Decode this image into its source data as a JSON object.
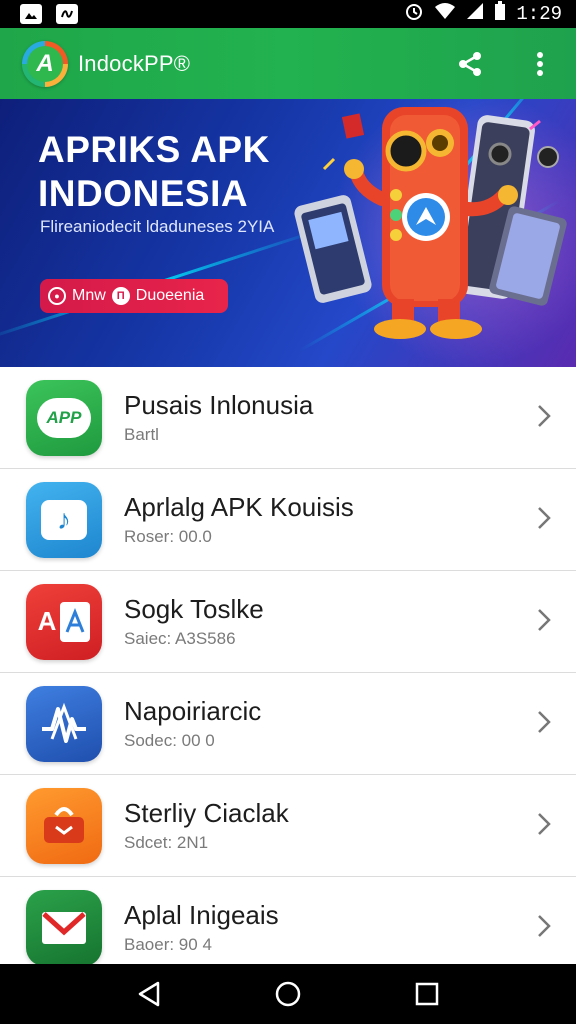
{
  "status_bar": {
    "time": "1:29",
    "icons": [
      "image-icon",
      "notification-icon",
      "alarm-icon",
      "wifi-icon",
      "signal-icon",
      "battery-icon"
    ]
  },
  "app_bar": {
    "logo_letter": "A",
    "title": "IndockPP®",
    "actions": [
      "share-icon",
      "more-vert-icon"
    ],
    "color": "#22b24f"
  },
  "banner": {
    "title_line1": "APRIKS APK",
    "title_line2": "INDONESIA",
    "subtitle": "Flireaniodecit ldaduneses 2YIA",
    "pill_left": "Mnw",
    "pill_right": "Duoeenia",
    "accent": "#e8244a"
  },
  "apps": [
    {
      "title": "Pusais Inlonusia",
      "subtitle": "Bartl",
      "icon": "app-logo-icon",
      "color": "#2db44a",
      "glyph": "APP"
    },
    {
      "title": "Aprlalg APK Kouisis",
      "subtitle": "Roser: 00.0",
      "icon": "music-note-icon",
      "color": "#2e9ee0",
      "glyph": "♪"
    },
    {
      "title": "Sogk Toslke",
      "subtitle": "Saiec: A3S586",
      "icon": "translate-icon",
      "color": "#e12d2d",
      "glyph": "A"
    },
    {
      "title": "Napoiriarcic",
      "subtitle": "Sodec: 00 0",
      "icon": "waveform-icon",
      "color": "#2b63c9",
      "glyph": "A"
    },
    {
      "title": "Sterliy Ciaclak",
      "subtitle": "Sdcet: 2N1",
      "icon": "toolbox-icon",
      "color": "#f57c1f",
      "glyph": ""
    },
    {
      "title": "Aplal Inigeais",
      "subtitle": "Baoer: 90 4",
      "icon": "mail-icon",
      "color": "#1e8c3a",
      "glyph": "M"
    }
  ],
  "nav_bar": {
    "buttons": [
      "back-icon",
      "home-icon",
      "recents-icon"
    ]
  }
}
